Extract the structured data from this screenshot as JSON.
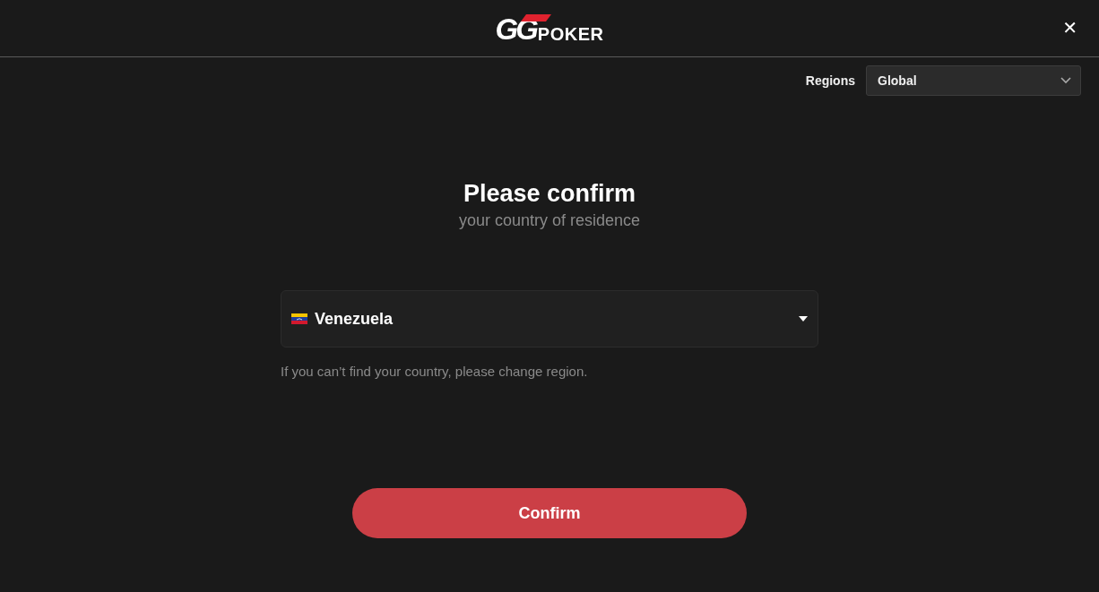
{
  "header": {
    "logo": {
      "mark": "GG",
      "word": "POKER"
    },
    "close": "✕"
  },
  "region": {
    "label": "Regions",
    "value": "Global"
  },
  "heading": {
    "title": "Please confirm",
    "subtitle": "your country of residence"
  },
  "country": {
    "value": "Venezuela",
    "hint": "If you can’t find your country, please change region."
  },
  "confirm": {
    "label": "Confirm"
  }
}
